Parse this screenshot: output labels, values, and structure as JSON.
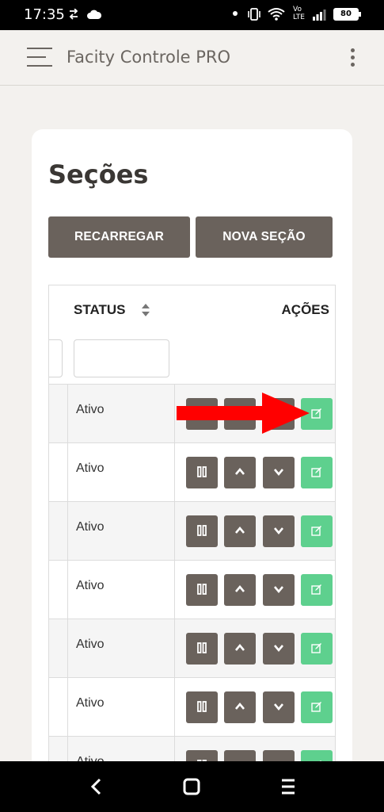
{
  "status_bar": {
    "time": "17:35",
    "lte_label_top": "Vo",
    "lte_label_bottom": "LTE",
    "battery": "80"
  },
  "app_bar": {
    "title": "Facity Controle PRO"
  },
  "page": {
    "title": "Seções",
    "buttons": {
      "reload": "RECARREGAR",
      "new_section": "NOVA SEÇÃO"
    },
    "table": {
      "columns": {
        "status": "STATUS",
        "actions": "AÇÕES"
      },
      "rows": [
        {
          "status": "Ativo"
        },
        {
          "status": "Ativo"
        },
        {
          "status": "Ativo"
        },
        {
          "status": "Ativo"
        },
        {
          "status": "Ativo"
        },
        {
          "status": "Ativo"
        },
        {
          "status": "Ativo"
        }
      ]
    }
  },
  "colors": {
    "action_dark": "#6a625c",
    "action_edit": "#5ed08e",
    "annotation_arrow": "#ff0000"
  }
}
